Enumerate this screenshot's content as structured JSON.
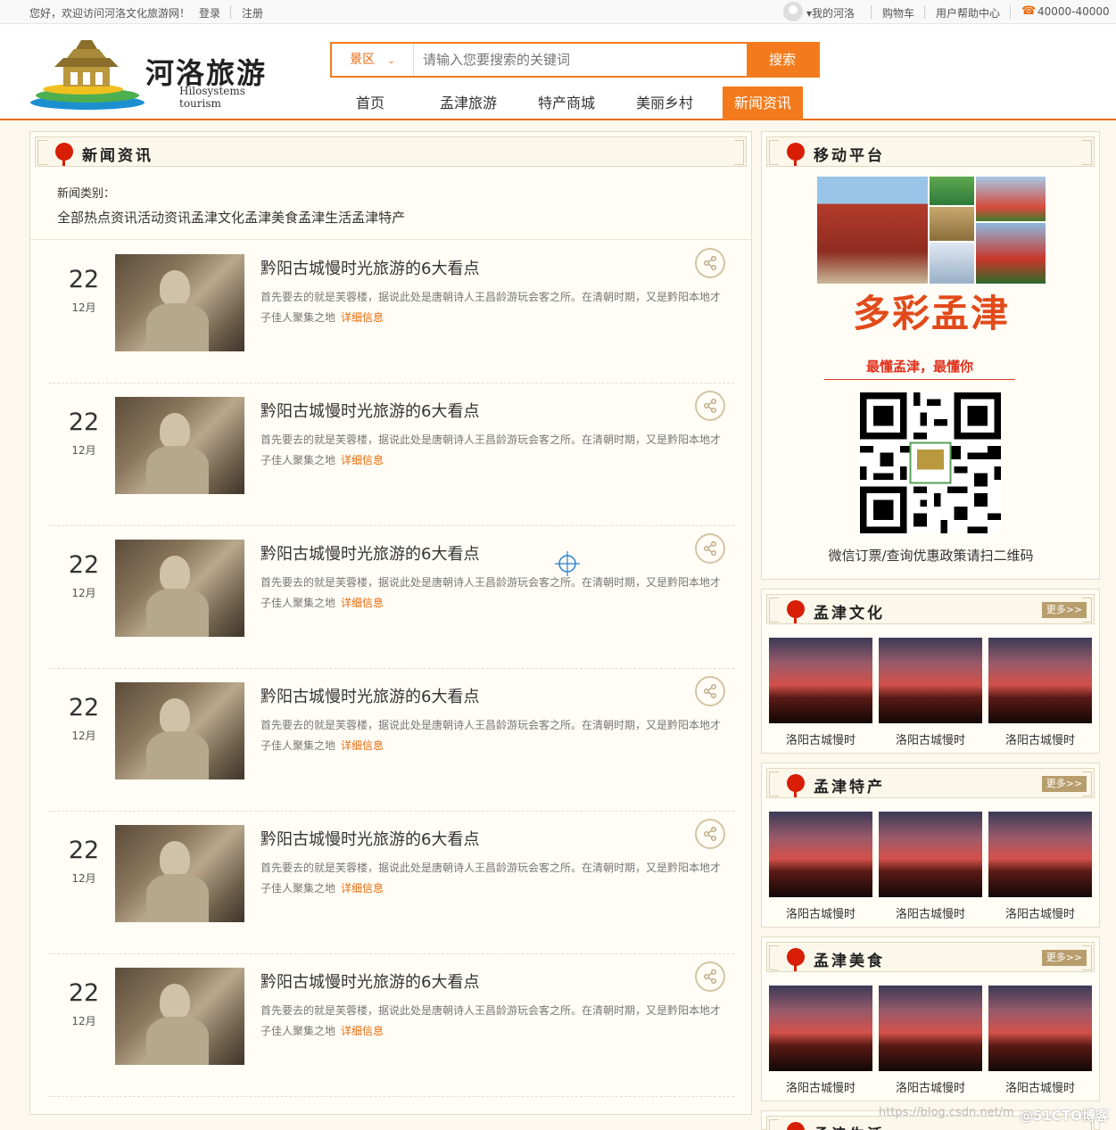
{
  "topbar": {
    "welcome": "您好，欢迎访问河洛文化旅游网！",
    "login": "登录",
    "register": "注册",
    "my_account": "▾我的河洛",
    "cart": "购物车",
    "help": "用户帮助中心",
    "phone": "40000-40000"
  },
  "logo": {
    "title": "河洛旅游",
    "subtitle": "Hilosystems tourism"
  },
  "search": {
    "category": "景区",
    "placeholder": "请输入您要搜索的关键词",
    "button": "搜索"
  },
  "nav": [
    {
      "label": "首页"
    },
    {
      "label": "孟津旅游"
    },
    {
      "label": "特产商城"
    },
    {
      "label": "美丽乡村"
    },
    {
      "label": "新闻资讯",
      "active": true
    }
  ],
  "news": {
    "title": "新闻资讯",
    "category_label": "新闻类别：",
    "categories": [
      "全部",
      "热点资讯",
      "活动资讯",
      "孟津文化",
      "孟津美食",
      "孟津生活",
      "孟津特产"
    ],
    "items": [
      {
        "day": "22",
        "month": "12月",
        "title": "黔阳古城慢时光旅游的6大看点",
        "desc": "首先要去的就是芙蓉楼，据说此处是唐朝诗人王昌龄游玩会客之所。在清朝时期，又是黔阳本地才子佳人聚集之地",
        "more": "详细信息"
      },
      {
        "day": "22",
        "month": "12月",
        "title": "黔阳古城慢时光旅游的6大看点",
        "desc": "首先要去的就是芙蓉楼，据说此处是唐朝诗人王昌龄游玩会客之所。在清朝时期，又是黔阳本地才子佳人聚集之地",
        "more": "详细信息"
      },
      {
        "day": "22",
        "month": "12月",
        "title": "黔阳古城慢时光旅游的6大看点",
        "desc": "首先要去的就是芙蓉楼，据说此处是唐朝诗人王昌龄游玩会客之所。在清朝时期，又是黔阳本地才子佳人聚集之地",
        "more": "详细信息"
      },
      {
        "day": "22",
        "month": "12月",
        "title": "黔阳古城慢时光旅游的6大看点",
        "desc": "首先要去的就是芙蓉楼，据说此处是唐朝诗人王昌龄游玩会客之所。在清朝时期，又是黔阳本地才子佳人聚集之地",
        "more": "详细信息"
      },
      {
        "day": "22",
        "month": "12月",
        "title": "黔阳古城慢时光旅游的6大看点",
        "desc": "首先要去的就是芙蓉楼，据说此处是唐朝诗人王昌龄游玩会客之所。在清朝时期，又是黔阳本地才子佳人聚集之地",
        "more": "详细信息"
      },
      {
        "day": "22",
        "month": "12月",
        "title": "黔阳古城慢时光旅游的6大看点",
        "desc": "首先要去的就是芙蓉楼，据说此处是唐朝诗人王昌龄游玩会客之所。在清朝时期，又是黔阳本地才子佳人聚集之地",
        "more": "详细信息"
      }
    ]
  },
  "mobile": {
    "title": "移动平台",
    "tagline": "多彩孟津",
    "slogan": "最懂孟津，最懂你",
    "qr_caption": "微信订票/查询优惠政策请扫二维码"
  },
  "sections": [
    {
      "title": "孟津文化",
      "more": "更多>>",
      "items": [
        "洛阳古城慢时",
        "洛阳古城慢时",
        "洛阳古城慢时"
      ]
    },
    {
      "title": "孟津特产",
      "more": "更多>>",
      "items": [
        "洛阳古城慢时",
        "洛阳古城慢时",
        "洛阳古城慢时"
      ]
    },
    {
      "title": "孟津美食",
      "more": "更多>>",
      "items": [
        "洛阳古城慢时",
        "洛阳古城慢时",
        "洛阳古城慢时"
      ]
    },
    {
      "title": "孟津生活"
    }
  ],
  "watermark": "https://blog.csdn.net/m",
  "watermark_brand": "@51CTO博客",
  "colors": {
    "accent": "#f37b1d",
    "link": "#e86a0c",
    "lantern": "#d81e06"
  }
}
